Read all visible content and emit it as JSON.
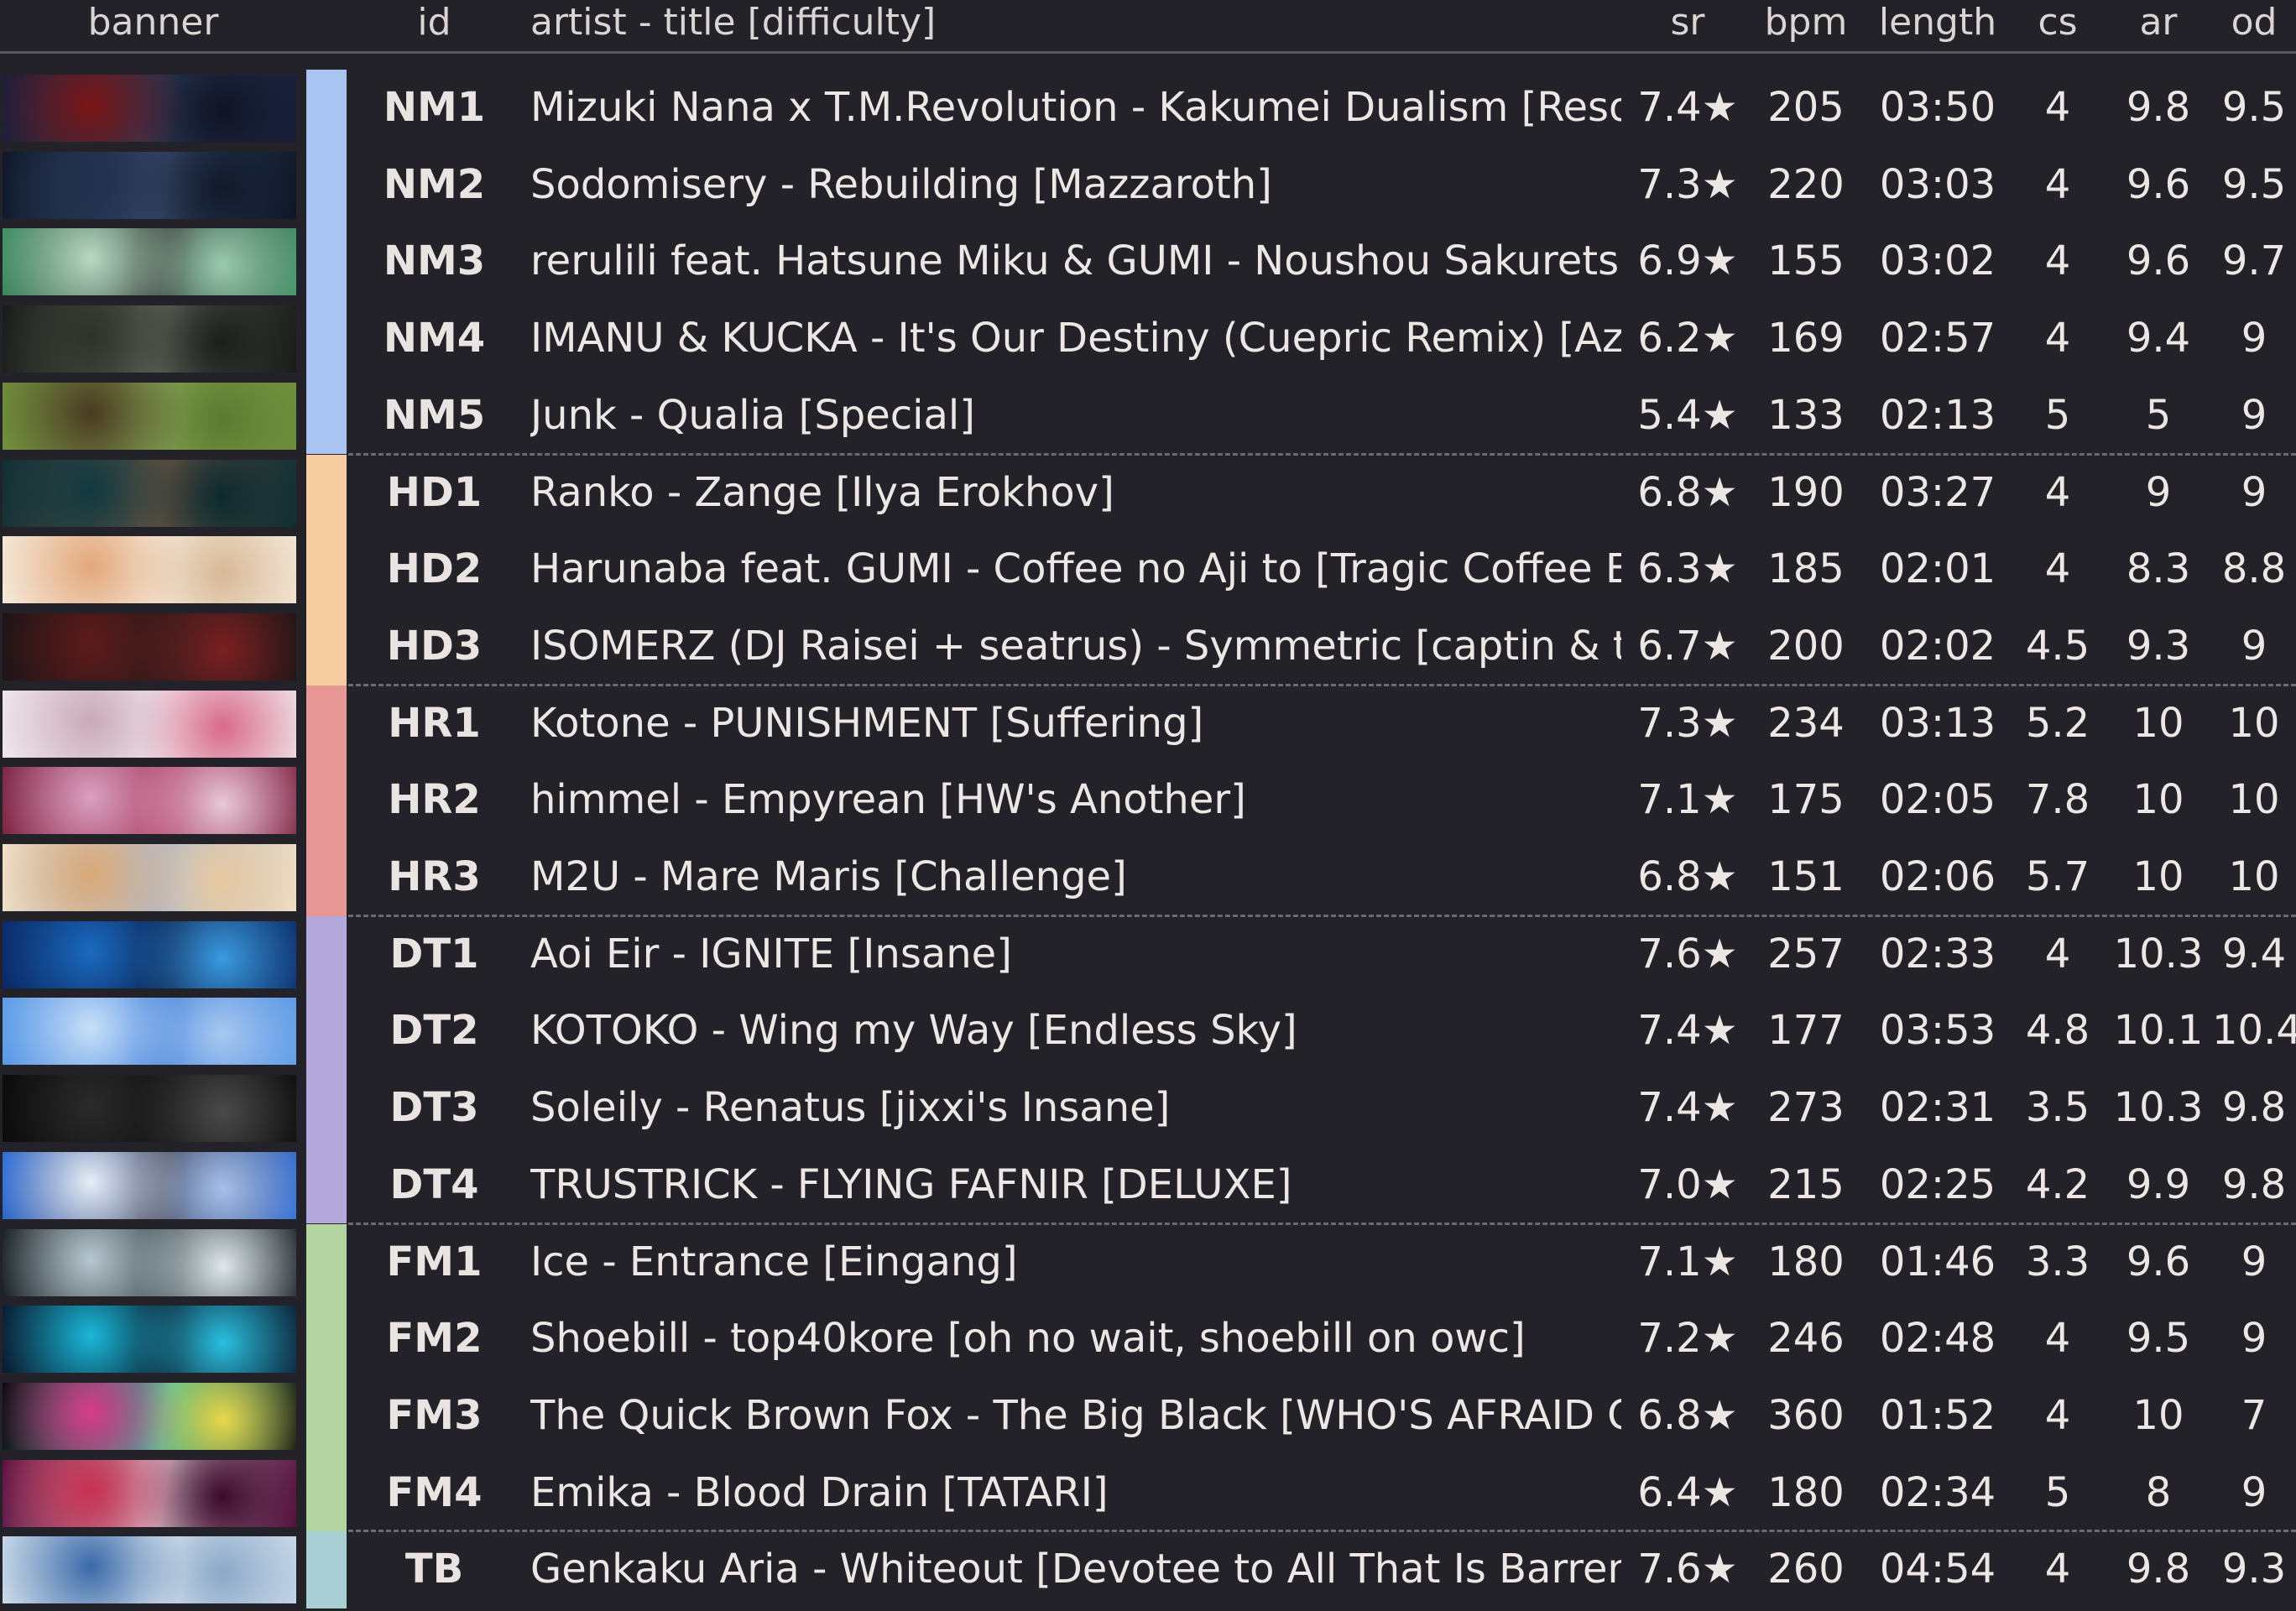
{
  "header": {
    "banner": "banner",
    "id": "id",
    "title": "artist - title [difficulty]",
    "sr": "sr",
    "bpm": "bpm",
    "length": "length",
    "cs": "cs",
    "ar": "ar",
    "od": "od"
  },
  "mod_colors": {
    "NM": "#A9C4F0",
    "HD": "#F6CDA0",
    "HR": "#E69795",
    "DT": "#B2A8DA",
    "FM": "#B4D4A2",
    "TB": "#A8CFD4"
  },
  "rows": [
    {
      "mod": "NM",
      "id": "NM1",
      "title": "Mizuki Nana x T.M.Revolution - Kakumei Dualism [Reso...",
      "sr": "7.4★",
      "bpm": "205",
      "length": "03:50",
      "cs": "4",
      "ar": "9.8",
      "od": "9.5",
      "banner": [
        "#1a1f3a",
        "#7a1616",
        "#2a3b5a",
        "#101425"
      ]
    },
    {
      "mod": "NM",
      "id": "NM2",
      "title": "Sodomisery - Rebuilding [Mazzaroth]",
      "sr": "7.3★",
      "bpm": "220",
      "length": "03:03",
      "cs": "4",
      "ar": "9.6",
      "od": "9.5",
      "banner": [
        "#0e1626",
        "#22314e",
        "#3b4d70",
        "#111a2a"
      ]
    },
    {
      "mod": "NM",
      "id": "NM3",
      "title": "rerulili feat. Hatsune Miku & GUMI - Noushou Sakuretsu...",
      "sr": "6.9★",
      "bpm": "155",
      "length": "03:02",
      "cs": "4",
      "ar": "9.6",
      "od": "9.7",
      "banner": [
        "#3e8f64",
        "#b9d9c4",
        "#2b2b2b",
        "#9bcab0"
      ]
    },
    {
      "mod": "NM",
      "id": "NM4",
      "title": "IMANU & KUCKA - It's Our Destiny (Cuepric Remix) [Azr...",
      "sr": "6.2★",
      "bpm": "169",
      "length": "02:57",
      "cs": "4",
      "ar": "9.4",
      "od": "9",
      "banner": [
        "#171a16",
        "#2e342c",
        "#6b6f66",
        "#1c1f1b"
      ]
    },
    {
      "mod": "NM",
      "id": "NM5",
      "title": "Junk - Qualia [Special]",
      "sr": "5.4★",
      "bpm": "133",
      "length": "02:13",
      "cs": "5",
      "ar": "5",
      "od": "9",
      "banner": [
        "#6f8f3a",
        "#4a3a22",
        "#8aa85a",
        "#5c7a30"
      ]
    },
    {
      "mod": "HD",
      "id": "HD1",
      "title": "Ranko - Zange [Ilya Erokhov]",
      "sr": "6.8★",
      "bpm": "190",
      "length": "03:27",
      "cs": "4",
      "ar": "9",
      "od": "9",
      "banner": [
        "#0f2f35",
        "#123a40",
        "#7a5a44",
        "#0d2a2f"
      ]
    },
    {
      "mod": "HD",
      "id": "HD2",
      "title": "Harunaba feat. GUMI - Coffee no Aji to [Tragic Coffee Ex..",
      "sr": "6.3★",
      "bpm": "185",
      "length": "02:01",
      "cs": "4",
      "ar": "8.3",
      "od": "8.8",
      "banner": [
        "#f4e8d8",
        "#e3a77a",
        "#f8f1e6",
        "#d8b896"
      ]
    },
    {
      "mod": "HD",
      "id": "HD3",
      "title": "ISOMERZ (DJ Raisei + seatrus) - Symmetric [captin & to...",
      "sr": "6.7★",
      "bpm": "200",
      "length": "02:02",
      "cs": "4.5",
      "ar": "9.3",
      "od": "9",
      "banner": [
        "#1b1416",
        "#5e1a1a",
        "#2a1a1c",
        "#7a2020"
      ]
    },
    {
      "mod": "HR",
      "id": "HR1",
      "title": "Kotone - PUNISHMENT [Suffering]",
      "sr": "7.3★",
      "bpm": "234",
      "length": "03:13",
      "cs": "5.2",
      "ar": "10",
      "od": "10",
      "banner": [
        "#efe6ea",
        "#c9a9b8",
        "#f5eef2",
        "#d86a8a"
      ]
    },
    {
      "mod": "HR",
      "id": "HR2",
      "title": "himmel - Empyrean [HW's Another]",
      "sr": "7.1★",
      "bpm": "175",
      "length": "02:05",
      "cs": "7.8",
      "ar": "10",
      "od": "10",
      "banner": [
        "#7a2340",
        "#d9a0c0",
        "#b03a60",
        "#e8c8d8"
      ]
    },
    {
      "mod": "HR",
      "id": "HR3",
      "title": "M2U - Mare Maris [Challenge]",
      "sr": "6.8★",
      "bpm": "151",
      "length": "02:06",
      "cs": "5.7",
      "ar": "10",
      "od": "10",
      "banner": [
        "#f2e2c8",
        "#d8a878",
        "#a8b8d0",
        "#e8c8a0"
      ]
    },
    {
      "mod": "DT",
      "id": "DT1",
      "title": "Aoi Eir - IGNITE [Insane]",
      "sr": "7.6★",
      "bpm": "257",
      "length": "02:33",
      "cs": "4",
      "ar": "10.3",
      "od": "9.4",
      "banner": [
        "#0a2a6a",
        "#1a6ac0",
        "#0a1a40",
        "#3a9ae0"
      ]
    },
    {
      "mod": "DT",
      "id": "DT2",
      "title": "KOTOKO - Wing my Way [Endless Sky]",
      "sr": "7.4★",
      "bpm": "177",
      "length": "03:53",
      "cs": "4.8",
      "ar": "10.1",
      "od": "10.4",
      "banner": [
        "#5a9ae8",
        "#c8e0f8",
        "#3a7ad8",
        "#a8c8f0"
      ]
    },
    {
      "mod": "DT",
      "id": "DT3",
      "title": "Soleily - Renatus [jixxi's Insane]",
      "sr": "7.4★",
      "bpm": "273",
      "length": "02:31",
      "cs": "3.5",
      "ar": "10.3",
      "od": "9.8",
      "banner": [
        "#0a0a0a",
        "#2a2a2a",
        "#111111",
        "#4a4a4a"
      ]
    },
    {
      "mod": "DT",
      "id": "DT4",
      "title": "TRUSTRICK - FLYING FAFNIR [DELUXE]",
      "sr": "7.0★",
      "bpm": "215",
      "length": "02:25",
      "cs": "4.2",
      "ar": "9.9",
      "od": "9.8",
      "banner": [
        "#2a6ad8",
        "#e8eef8",
        "#3a3a4a",
        "#a8c0e8"
      ]
    },
    {
      "mod": "FM",
      "id": "FM1",
      "title": "Ice - Entrance [Eingang]",
      "sr": "7.1★",
      "bpm": "180",
      "length": "01:46",
      "cs": "3.3",
      "ar": "9.6",
      "od": "9",
      "banner": [
        "#1a2024",
        "#b8c8d0",
        "#3a4a50",
        "#e0e8ec"
      ]
    },
    {
      "mod": "FM",
      "id": "FM2",
      "title": "Shoebill - top40kore [oh no wait, shoebill on owc]",
      "sr": "7.2★",
      "bpm": "246",
      "length": "02:48",
      "cs": "4",
      "ar": "9.5",
      "od": "9",
      "banner": [
        "#0a1a30",
        "#1ab8d8",
        "#0a0a18",
        "#2ac0e0"
      ]
    },
    {
      "mod": "FM",
      "id": "FM3",
      "title": "The Quick Brown Fox - The Big Black [WHO'S AFRAID OF..",
      "sr": "6.8★",
      "bpm": "360",
      "length": "01:52",
      "cs": "4",
      "ar": "10",
      "od": "7",
      "banner": [
        "#0a0a0e",
        "#d83a8a",
        "#3ac8a8",
        "#e8d84a"
      ]
    },
    {
      "mod": "FM",
      "id": "FM4",
      "title": "Emika - Blood Drain [TATARI]",
      "sr": "6.4★",
      "bpm": "180",
      "length": "02:34",
      "cs": "5",
      "ar": "8",
      "od": "9",
      "banner": [
        "#5a1040",
        "#c83050",
        "#e8d8e0",
        "#3a0a2a"
      ]
    },
    {
      "mod": "TB",
      "id": "TB",
      "title": "Genkaku Aria - Whiteout [Devotee to All That Is Barren]",
      "sr": "7.6★",
      "bpm": "260",
      "length": "04:54",
      "cs": "4",
      "ar": "9.8",
      "od": "9.3",
      "banner": [
        "#c8d8e8",
        "#3a6aa8",
        "#e8eef4",
        "#8aa8c8"
      ]
    }
  ]
}
